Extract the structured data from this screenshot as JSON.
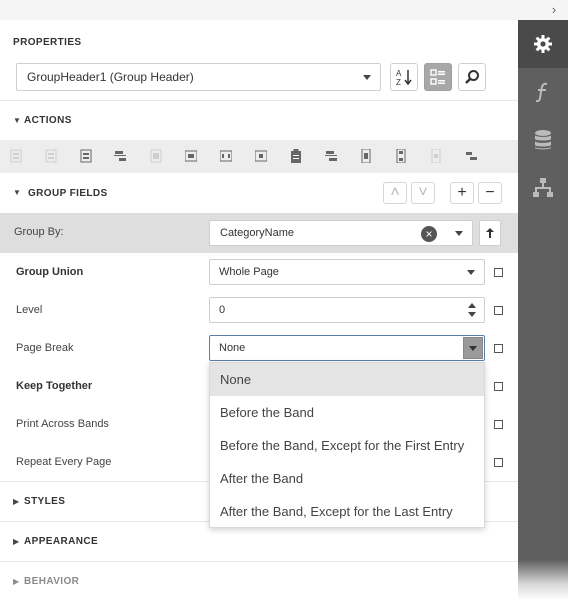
{
  "properties": {
    "title": "PROPERTIES",
    "selected_object": "GroupHeader1 (Group Header)",
    "toolbar": {
      "sort_icon": "sort-alpha-icon",
      "categories_icon": "categorized-icon",
      "search_icon": "search-icon"
    }
  },
  "sidebar": {
    "tabs": [
      "settings-gear-icon",
      "function-icon",
      "database-icon",
      "report-tree-icon"
    ],
    "active": "settings-gear-icon"
  },
  "sections": {
    "actions": "ACTIONS",
    "group_fields": "GROUP FIELDS",
    "styles": "STYLES",
    "appearance": "APPEARANCE",
    "behavior": "BEHAVIOR"
  },
  "group_fields": {
    "buttons": {
      "up": "˄",
      "down": "˅",
      "add": "+",
      "remove": "−"
    },
    "group_by": {
      "label": "Group By:",
      "value": "CategoryName"
    }
  },
  "props": {
    "group_union": {
      "label": "Group Union",
      "value": "Whole Page"
    },
    "level": {
      "label": "Level",
      "value": "0"
    },
    "page_break": {
      "label": "Page Break",
      "value": "None"
    },
    "keep_together": {
      "label": "Keep Together"
    },
    "print_across_bands": {
      "label": "Print Across Bands"
    },
    "repeat_every_page": {
      "label": "Repeat Every Page"
    }
  },
  "page_break_options": [
    "None",
    "Before the Band",
    "Before the Band, Except for the First Entry",
    "After the Band",
    "After the Band, Except for the Last Entry"
  ],
  "page_break_selected_index": 0,
  "colors": {
    "sidebar": "#5f5f5f",
    "sidebar_active": "#4a4a4a",
    "row_highlight": "#dedede",
    "focus_border": "#5b7fa8"
  }
}
